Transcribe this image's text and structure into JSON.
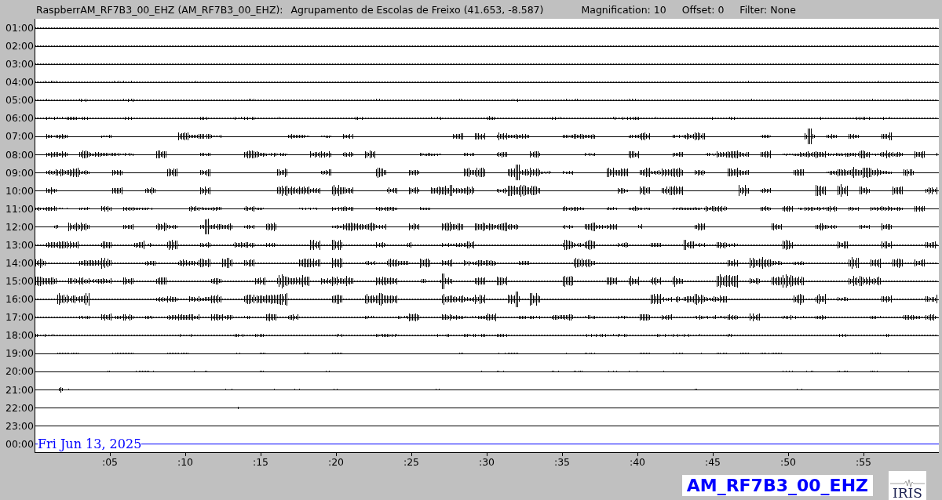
{
  "header": {
    "channel": "RaspberrAM_RF7B3_00_EHZ (AM_RF7B3_00_EHZ):",
    "location": "Agrupamento de Escolas de Freixo (41.653, -8.587)",
    "magnification": "Magnification: 10",
    "offset": "Offset: 0",
    "filter": "Filter: None"
  },
  "rows": [
    {
      "label": "01:00",
      "color": "#000000"
    },
    {
      "label": "02:00",
      "color": "#000000"
    },
    {
      "label": "03:00",
      "color": "#000000"
    },
    {
      "label": "04:00",
      "color": "#000000"
    },
    {
      "label": "05:00",
      "color": "#000000"
    },
    {
      "label": "06:00",
      "color": "#000000"
    },
    {
      "label": "07:00",
      "color": "#000000"
    },
    {
      "label": "08:00",
      "color": "#000000"
    },
    {
      "label": "09:00",
      "color": "#000000"
    },
    {
      "label": "10:00",
      "color": "#000000"
    },
    {
      "label": "11:00",
      "color": "#000000"
    },
    {
      "label": "12:00",
      "color": "#000000"
    },
    {
      "label": "13:00",
      "color": "#000000"
    },
    {
      "label": "14:00",
      "color": "#000000"
    },
    {
      "label": "15:00",
      "color": "#000000"
    },
    {
      "label": "16:00",
      "color": "#000000"
    },
    {
      "label": "17:00",
      "color": "#000000"
    },
    {
      "label": "18:00",
      "color": "#000000"
    },
    {
      "label": "19:00",
      "color": "#000000"
    },
    {
      "label": "20:00",
      "color": "#000000"
    },
    {
      "label": "21:00",
      "color": "#000000"
    },
    {
      "label": "22:00",
      "color": "#000000"
    },
    {
      "label": "23:00",
      "color": "#000000"
    },
    {
      "label": "00:00",
      "color": "#0000ff"
    }
  ],
  "date": "Fri Jun 13, 2025",
  "time_axis": {
    "ticks": [
      ":05",
      ":10",
      ":15",
      ":20",
      ":25",
      ":30",
      ":35",
      ":40",
      ":45",
      ":50",
      ":55"
    ]
  },
  "station_label": "AM_RF7B3_00_EHZ",
  "logo": {
    "text": "IRIS"
  }
}
